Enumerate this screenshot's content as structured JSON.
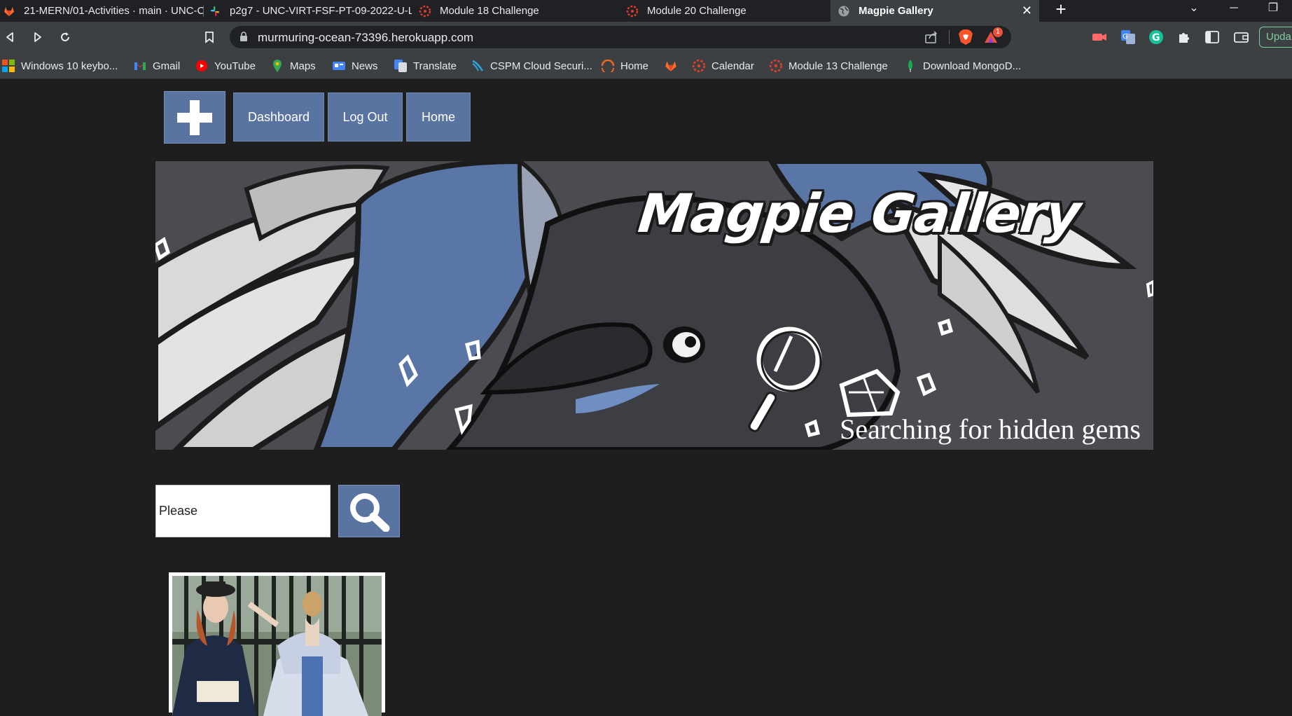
{
  "browser": {
    "tabs": [
      {
        "title": "21-MERN/01-Activities · main · UNC-C",
        "icon": "gitlab-icon",
        "active": false
      },
      {
        "title": "p2g7 - UNC-VIRT-FSF-PT-09-2022-U-L",
        "icon": "slack-icon",
        "active": false
      },
      {
        "title": "Module 18 Challenge",
        "icon": "canvas-icon",
        "active": false
      },
      {
        "title": "Module 20 Challenge",
        "icon": "canvas-icon",
        "active": false
      },
      {
        "title": "Magpie Gallery",
        "icon": "globe-icon",
        "active": true
      }
    ],
    "new_tab": "+",
    "url": "murmuring-ocean-73396.herokuapp.com",
    "rewards_badge": "1",
    "update_label": "Upda",
    "bookmarks": [
      {
        "label": "Windows 10 keybo...",
        "icon": "windows-icon"
      },
      {
        "label": "Gmail",
        "icon": "gmail-icon"
      },
      {
        "label": "YouTube",
        "icon": "youtube-icon"
      },
      {
        "label": "Maps",
        "icon": "maps-icon"
      },
      {
        "label": "News",
        "icon": "news-icon"
      },
      {
        "label": "Translate",
        "icon": "translate-icon"
      },
      {
        "label": "CSPM Cloud Securi...",
        "icon": "cspm-icon"
      },
      {
        "label": "Home",
        "icon": "home-arc-icon"
      },
      {
        "label": "",
        "icon": "gitlab-icon"
      },
      {
        "label": "Calendar",
        "icon": "canvas-icon"
      },
      {
        "label": "Module 13 Challenge",
        "icon": "canvas-icon"
      },
      {
        "label": "Download MongoD...",
        "icon": "mongodb-icon"
      }
    ]
  },
  "site": {
    "nav": {
      "add_icon": "plus-icon",
      "dashboard": "Dashboard",
      "logout": "Log Out",
      "home": "Home"
    },
    "banner": {
      "title": "Magpie Gallery",
      "tagline": "Searching for hidden gems"
    },
    "search": {
      "value": "Please",
      "button_icon": "search-icon"
    },
    "colors": {
      "accent": "#5a74a1",
      "background": "#1e1e1e"
    }
  }
}
